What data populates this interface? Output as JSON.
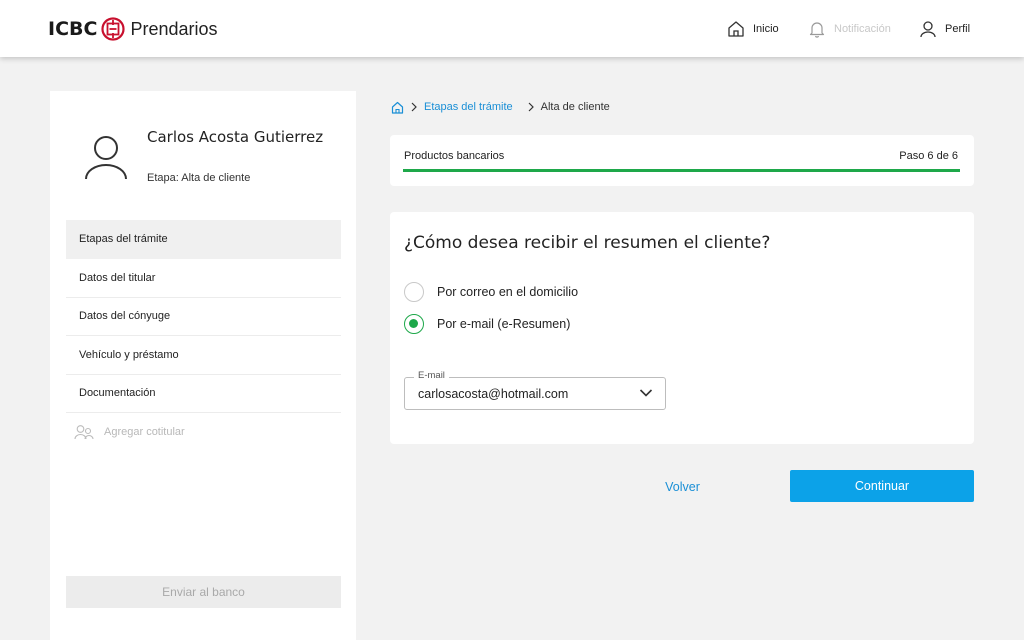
{
  "header": {
    "brand_left": "ICBC",
    "brand_right": "Prendarios",
    "nav": {
      "home_label": "Inicio",
      "notifications_label": "Notificación",
      "profile_label": "Perfil"
    }
  },
  "sidebar": {
    "user_name": "Carlos Acosta Gutierrez",
    "stage": "Etapa: Alta de cliente",
    "menu": [
      {
        "label": "Etapas del trámite",
        "active": true
      },
      {
        "label": "Datos del titular"
      },
      {
        "label": "Datos del cónyuge"
      },
      {
        "label": "Vehículo y préstamo"
      },
      {
        "label": "Documentación"
      },
      {
        "label": "Agregar cotitular",
        "disabled": true
      }
    ],
    "send_button": "Enviar al banco"
  },
  "breadcrumb": {
    "items": [
      "Etapas del trámite",
      "Alta de cliente"
    ]
  },
  "progress": {
    "label": "Productos bancarios",
    "step": "Paso 6 de 6",
    "fraction": 1.0
  },
  "form": {
    "question": "¿Cómo desea recibir el resumen el cliente?",
    "options": [
      {
        "label": "Por correo en el domicilio",
        "selected": false
      },
      {
        "label": "Por e-mail (e-Resumen)",
        "selected": true
      }
    ],
    "email_field": {
      "label": "E-mail",
      "value": "carlosacosta@hotmail.com"
    }
  },
  "actions": {
    "back": "Volver",
    "continue": "Continuar"
  },
  "colors": {
    "accent_blue": "#0ca2e8",
    "link_blue": "#1a8fd6",
    "success_green": "#1ea84a",
    "brand_red": "#c8102e"
  }
}
